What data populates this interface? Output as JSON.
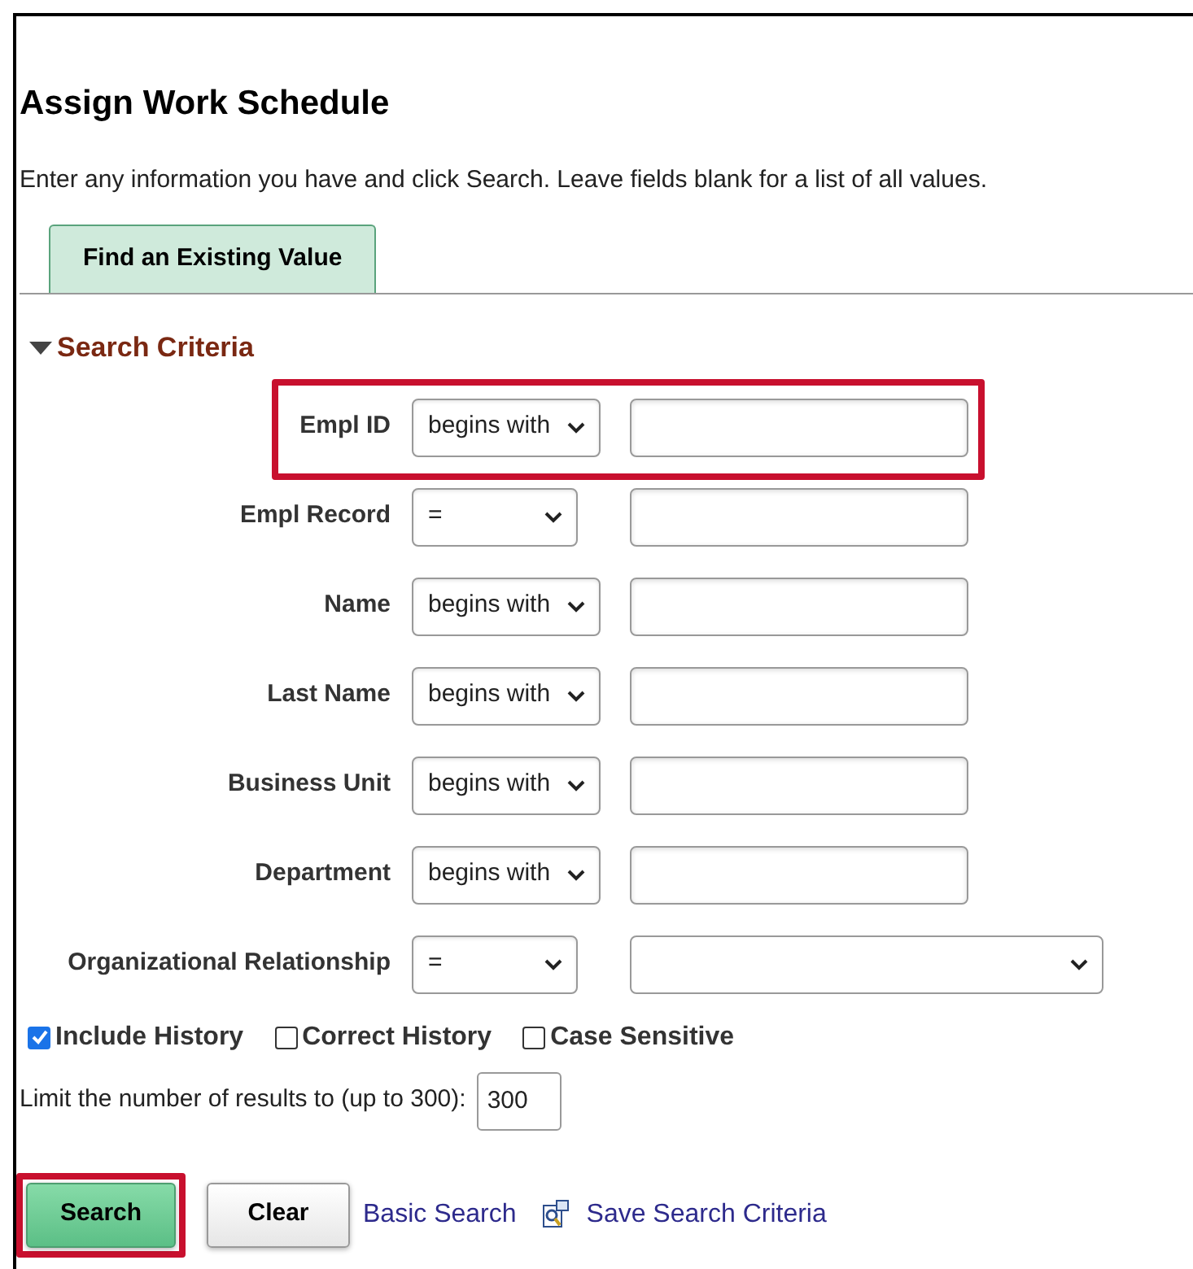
{
  "page": {
    "title": "Assign Work Schedule",
    "instructions": "Enter any information you have and click Search. Leave fields blank for a list of all values."
  },
  "tabs": [
    {
      "label": "Find an Existing Value",
      "selected": true
    }
  ],
  "section": {
    "label": "Search Criteria",
    "expanded": true
  },
  "criteria": [
    {
      "label": "Empl ID",
      "operator": "begins with",
      "kind": "text",
      "highlighted": true
    },
    {
      "label": "Empl Record",
      "operator": "=",
      "kind": "text",
      "highlighted": false
    },
    {
      "label": "Name",
      "operator": "begins with",
      "kind": "text",
      "highlighted": false
    },
    {
      "label": "Last Name",
      "operator": "begins with",
      "kind": "text",
      "highlighted": false
    },
    {
      "label": "Business Unit",
      "operator": "begins with",
      "kind": "text",
      "highlighted": false
    },
    {
      "label": "Department",
      "operator": "begins with",
      "kind": "text",
      "highlighted": false
    },
    {
      "label": "Organizational Relationship",
      "operator": "=",
      "kind": "dropdown",
      "highlighted": false
    }
  ],
  "options": [
    {
      "label": "Include History",
      "checked": true
    },
    {
      "label": "Correct History",
      "checked": false
    },
    {
      "label": "Case Sensitive",
      "checked": false
    }
  ],
  "limit": {
    "label": "Limit the number of results to (up to 300):",
    "value": "300"
  },
  "buttons": [
    {
      "label": "Search",
      "kind": "primary",
      "highlighted": true
    },
    {
      "label": "Clear",
      "kind": "secondary",
      "highlighted": false
    }
  ],
  "links": [
    {
      "label": "Basic Search",
      "kind": "plain"
    },
    {
      "label": "Save Search Criteria",
      "kind": "save"
    }
  ]
}
